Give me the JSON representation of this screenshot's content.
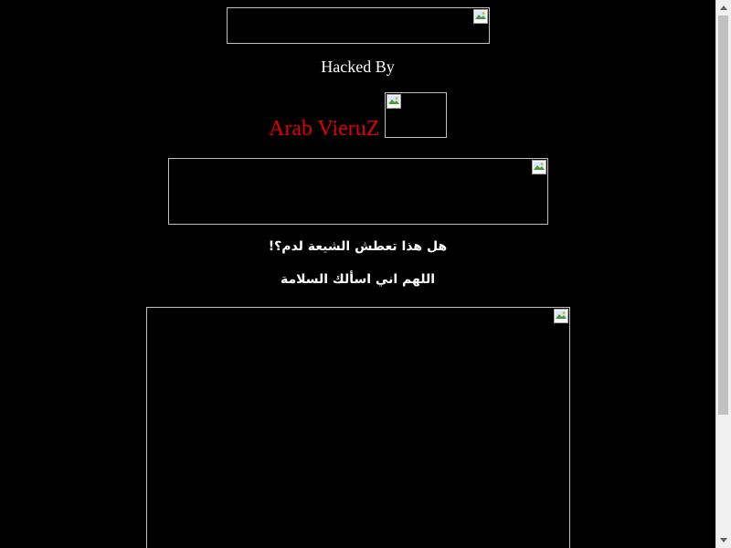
{
  "page": {
    "background_color": "#000000",
    "hacked_by_text": "Hacked By",
    "author_name": "Arab VieruZ",
    "author_color": "#e00000",
    "arabic_line_1": "هل هذا تعطش الشيعة لدم؟!",
    "arabic_line_2": "اللهم اني اسألك السلامة"
  },
  "images": [
    {
      "name": "banner-image",
      "state": "broken"
    },
    {
      "name": "author-image",
      "state": "broken"
    },
    {
      "name": "middle-image",
      "state": "broken"
    },
    {
      "name": "main-image",
      "state": "broken"
    }
  ],
  "scrollbar": {
    "scroll_position": 0,
    "visible_fraction": 0.75,
    "icons": [
      "arrow-up-icon",
      "arrow-down-icon"
    ]
  }
}
